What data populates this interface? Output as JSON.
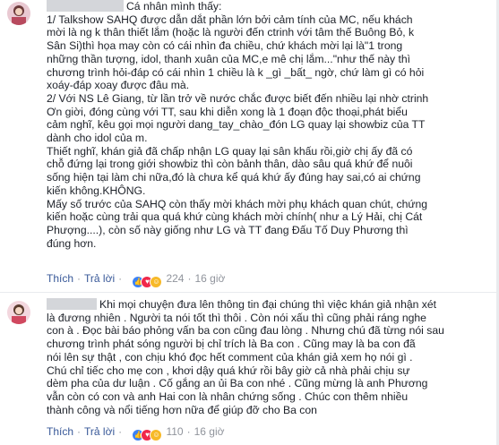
{
  "comment1": {
    "avatar_icon": "user-avatar-icon",
    "lines": [
      "Cá nhân mình thấy:",
      "1/ Talkshow SAHQ được dẫn dắt phần lớn bởi cảm tính của MC, nếu khách",
      "mời là ng k thân thiết lắm (hoặc là người đến ctrinh với tâm thế Buông Bỏ, k",
      "Sân Si)thì họa may còn có cái nhìn đa chiều, chứ khách mời lại là\"1 trong",
      "những thần tượng, idol, thanh xuân của MC,e mê chị lắm...\"như thế này thì",
      "chương trình hỏi-đáp có cái nhìn 1 chiều là k _gì _bất_ ngờ, chứ làm gì có hỏi",
      "xoáy-đáp xoay được đâu mà.",
      "2/ Với NS Lê Giang, từ lần trở về nước chắc được biết đến nhiều lại nhờ ctrinh",
      "Ơn giời, đóng cùng với TT, sau khi diễn xong là 1 đoạn độc thoại,phát biểu",
      "cảm nghĩ, kêu gọi mọi người dang_tay_chào_đón LG quay lại showbiz của TT",
      "dành cho idol của m.",
      "Thiết nghĩ, khán giả đã chấp nhận LG quay lại sân khấu rồi,giờ chị ấy đã có",
      "chỗ đứng lại trong giới showbiz thì còn bảnh thân, dào sâu quá khứ để nuôi",
      "sống hiện tại làm chi nữa,đó là chưa kể quá khứ ấy đúng hay sai,có ai chứng",
      "kiến không.KHÔNG.",
      "Mấy số trước của SAHQ còn thấy mời khách mời phụ khách quan chút, chứng",
      "kiến hoặc cùng trải qua quá khứ cùng khách mời chính( như a Lý Hải, chị Cát",
      "Phượng....), còn số này giống như LG và TT đang Đấu Tố Duy Phương thì",
      "đúng hơn."
    ],
    "actions": {
      "like": "Thích",
      "reply": "Trả lời",
      "reactions": "224",
      "time": "16 giờ"
    }
  },
  "comment2": {
    "avatar_icon": "user-avatar-icon",
    "lines": [
      "Khi mọi chuyện đưa lên thông tin đại chúng thì việc khán giả nhận xét",
      "là đương nhiên . Người ta nói tốt thì thôi . Còn nói xấu thì cũng phải ráng nghe",
      "con à . Đọc bài báo phỏng vấn ba con cũng đau lòng . Nhưng chú đã từng nói sau",
      "chương trình phát sóng người bị chỉ trích là Ba con . Cũng may là ba con đã",
      "nói lên sự thật , con chịu khó đọc hết comment của khán giả xem họ nói gì .",
      "Chú chỉ tiếc cho mẹ con , khơi dậy quá khứ rồi bây giờ cả nhà phải chịu sự",
      "dèm pha của dư luận . Cố gắng an ủi Ba con nhé . Cũng mừng là anh Phương",
      "vẫn còn có con và anh Hai con là nhân chứng sống . Chúc con thêm nhiều",
      "thành công và nổi tiếng hơn nữa để giúp đỡ cho Ba con"
    ],
    "actions": {
      "like": "Thích",
      "reply": "Trả lời",
      "reactions": "110",
      "time": "16 giờ"
    }
  },
  "colors": {
    "link": "#385898",
    "text": "#1d2129",
    "meta": "#90949c"
  }
}
